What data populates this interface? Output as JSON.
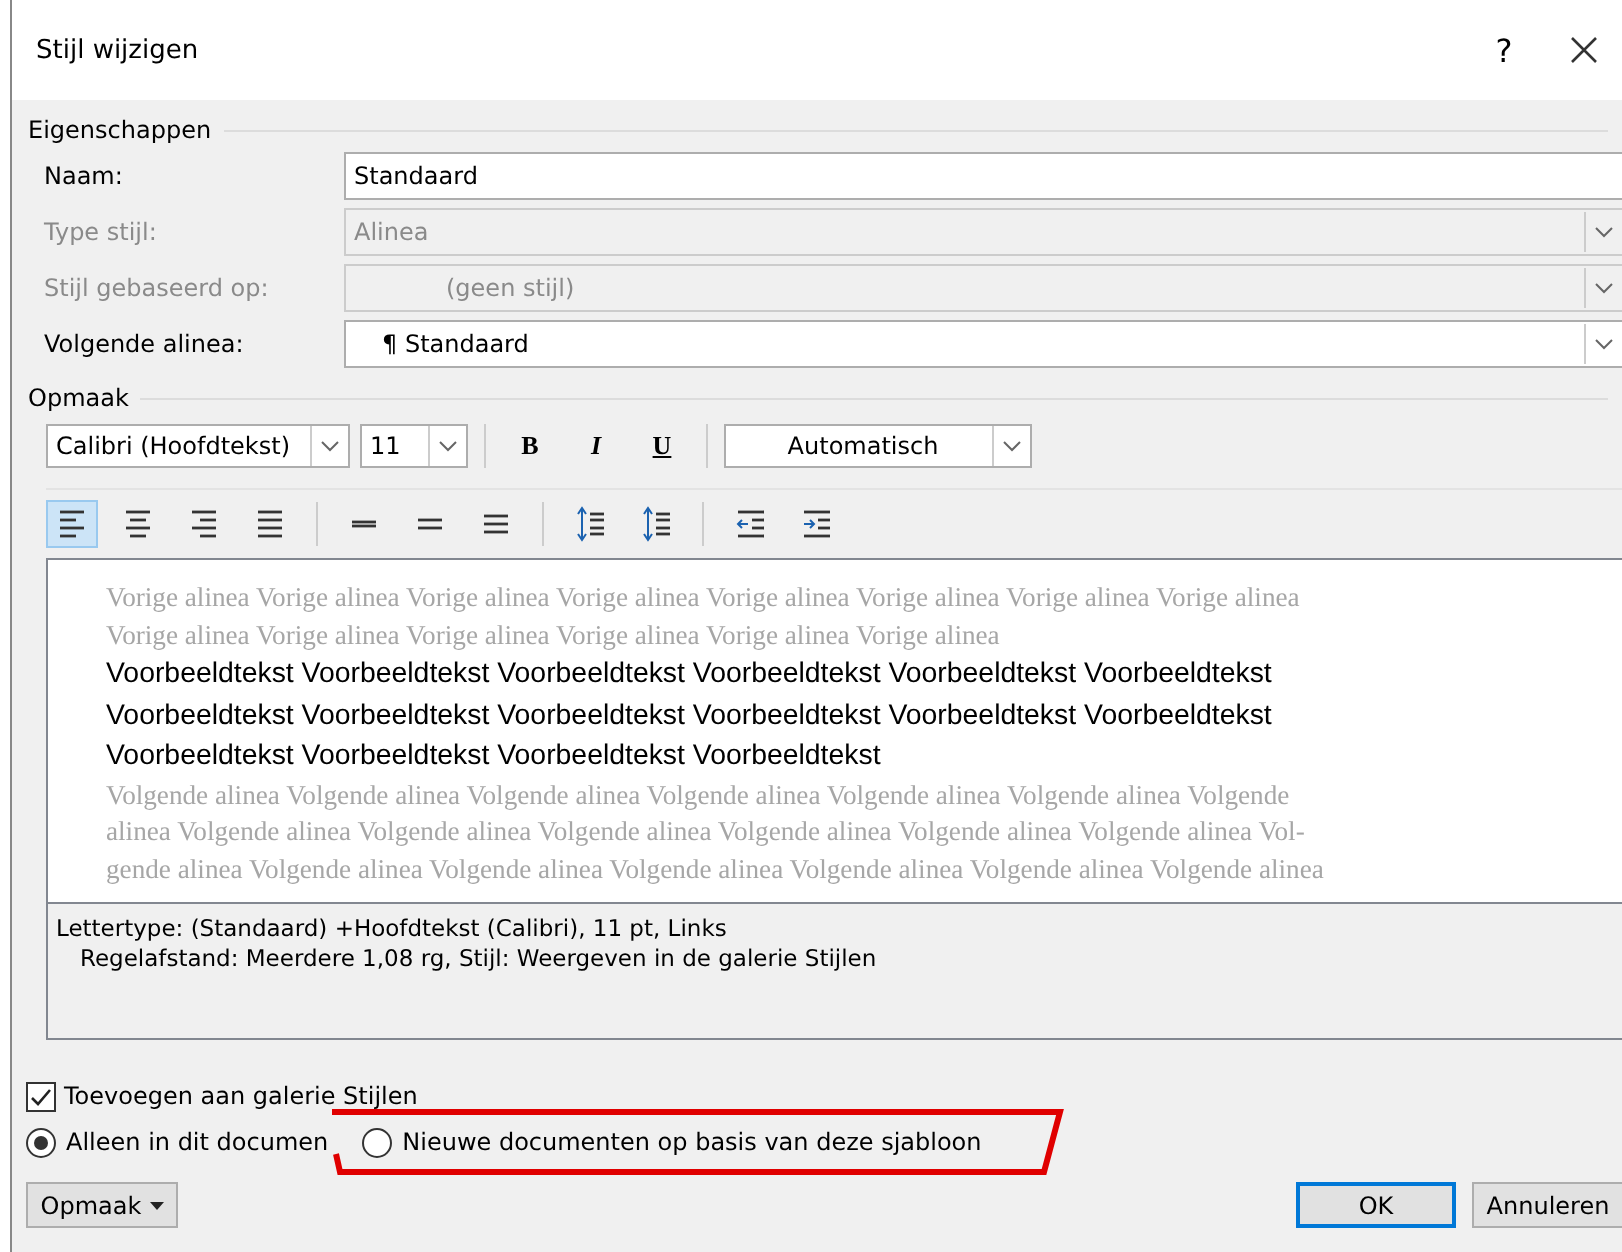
{
  "window": {
    "title": "Stijl wijzigen",
    "help": "?"
  },
  "properties": {
    "legend": "Eigenschappen",
    "fields": [
      {
        "label": "Naam:",
        "value": "Standaard",
        "kind": "text",
        "disabled": false
      },
      {
        "label": "Type stijl:",
        "value": "Alinea",
        "kind": "select",
        "disabled": true
      },
      {
        "label": "Stijl gebaseerd op:",
        "value": "(geen stijl)",
        "kind": "select",
        "disabled": true
      },
      {
        "label": "Volgende alinea:",
        "value": "Standaard",
        "mark": "¶",
        "kind": "select",
        "disabled": false
      }
    ]
  },
  "format": {
    "legend": "Opmaak",
    "font": "Calibri (Hoofdtekst)",
    "size": "11",
    "bold": "B",
    "italic": "I",
    "underline": "U",
    "font_color": "Automatisch",
    "paragraph_buttons": [
      {
        "kind": "align-left",
        "selected": true
      },
      {
        "kind": "align-center",
        "selected": false
      },
      {
        "kind": "align-right",
        "selected": false
      },
      {
        "kind": "justify",
        "selected": false
      },
      {
        "kind": "spacing-single",
        "selected": false
      },
      {
        "kind": "spacing-half",
        "selected": false
      },
      {
        "kind": "spacing-double",
        "selected": false
      },
      {
        "kind": "space-before",
        "selected": false
      },
      {
        "kind": "space-after",
        "selected": false
      },
      {
        "kind": "outdent",
        "selected": false
      },
      {
        "kind": "indent",
        "selected": false
      }
    ]
  },
  "preview": {
    "lines": [
      {
        "kind": "previous",
        "text": "Vorige alinea Vorige alinea Vorige alinea Vorige alinea Vorige alinea Vorige alinea Vorige alinea Vorige alinea"
      },
      {
        "kind": "previous",
        "text": "Vorige alinea Vorige alinea Vorige alinea Vorige alinea Vorige alinea Vorige alinea"
      },
      {
        "kind": "sample",
        "text": "Voorbeeldtekst Voorbeeldtekst Voorbeeldtekst Voorbeeldtekst Voorbeeldtekst Voorbeeldtekst"
      },
      {
        "kind": "sample",
        "text": "Voorbeeldtekst Voorbeeldtekst Voorbeeldtekst Voorbeeldtekst Voorbeeldtekst Voorbeeldtekst"
      },
      {
        "kind": "sample",
        "text": "Voorbeeldtekst Voorbeeldtekst Voorbeeldtekst Voorbeeldtekst"
      },
      {
        "kind": "next",
        "text": "Volgende alinea Volgende alinea Volgende alinea Volgende alinea Volgende alinea Volgende alinea Volgende"
      },
      {
        "kind": "next",
        "text": "alinea Volgende alinea Volgende alinea Volgende alinea Volgende alinea Volgende alinea Volgende alinea Vol-"
      },
      {
        "kind": "next",
        "text": "gende alinea Volgende alinea Volgende alinea Volgende alinea Volgende alinea Volgende alinea Volgende alinea"
      }
    ]
  },
  "description": [
    "Lettertype: (Standaard) +Hoofdtekst (Calibri), 11 pt, Links",
    "Regelafstand:  Meerdere 1,08 rg, Stijl: Weergeven in de galerie Stijlen"
  ],
  "add_to_gallery": {
    "label": "Toevoegen aan galerie Stijlen",
    "checked": true
  },
  "scope": [
    {
      "label": "Alleen in dit documen",
      "selected": true
    },
    {
      "label": "Nieuwe documenten op basis van deze sjabloon",
      "selected": false,
      "annotated": true
    }
  ],
  "buttons": [
    {
      "label": "Opmaak",
      "kind": "menu"
    },
    {
      "label": "OK",
      "kind": "default"
    },
    {
      "label": "Annuleren",
      "kind": "normal"
    }
  ]
}
